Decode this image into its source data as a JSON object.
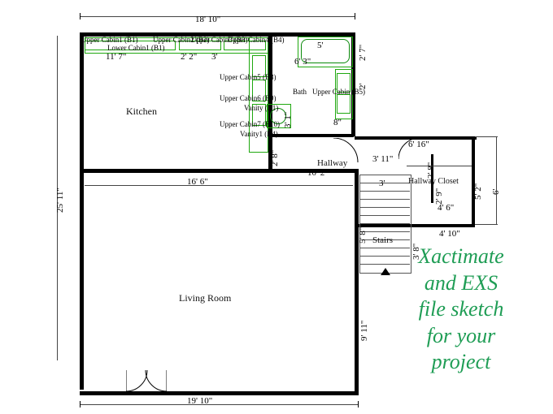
{
  "rooms": {
    "kitchen": "Kitchen",
    "living": "Living Room",
    "hallway": "Hallway",
    "stairs": "Stairs",
    "hallway_closet": "Hallway Closet"
  },
  "cabinets": {
    "uc1": "Upper Cabin1 (B1)",
    "lc1": "Lower Cabin1 (B1)",
    "uc2": "Upper Cabin2 (B2)",
    "uc3": "Upper Cabin3 (B3)",
    "uc4": "Upper Cabin4 (B4)",
    "uc5": "Upper Cabin5 (B8)",
    "uc6": "Upper Cabin6 (B9)",
    "uc7": "Upper Cabin7 (B10)",
    "vanity": "Vanity (B1)",
    "vanity1": "Vanity1 (B4)",
    "bath_upper": "Upper Cabin (B5)",
    "bath_label": "Bath"
  },
  "dims": {
    "top_main": "18' 10\"",
    "left_main": "25' 11\"",
    "living_top": "16' 6\"",
    "bottom": "19' 10\"",
    "kitchen_c1": "11' 7\"",
    "kitchen_c2": "2' 2\"",
    "kitchen_c3": "3'",
    "tub_w": "5'",
    "tub_h": "6' 3\"",
    "hall_w": "10' 2\"",
    "hall_h1": "2' 8\"",
    "hall_h2": "3' 1\"",
    "hc_w": "4' 6\"",
    "hc_h": "2' 8\"",
    "hc_h2": "2' 9\"",
    "hc_h3": "5' 2\"",
    "right_ext": "4' 10\"",
    "right6": "6'",
    "r616": "6' 16\"",
    "hall311": "3' 11\"",
    "stairs3": "3'",
    "stairs58": "5' 8\"",
    "stairs38": "3' 8\"",
    "lr911": "9' 11\"",
    "small2": "2'",
    "small27": "2' 7\"",
    "small8": "8\""
  },
  "promo": {
    "l1": "Xactimate",
    "l2": "and EXS",
    "l3": "file sketch",
    "l4": "for your",
    "l5": "project"
  }
}
